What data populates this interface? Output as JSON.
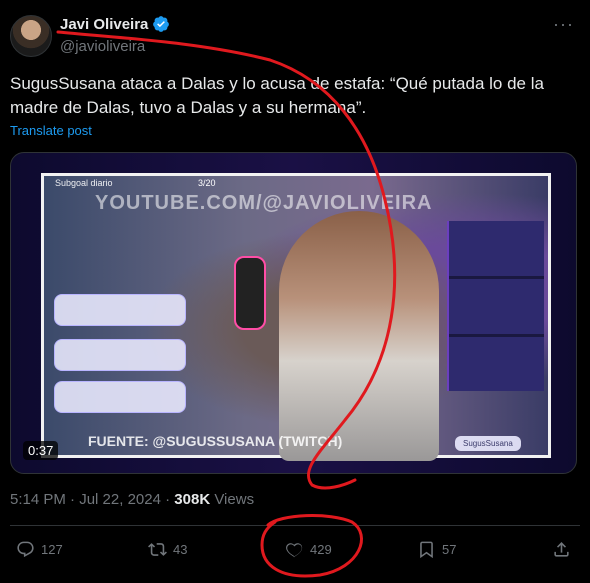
{
  "author": {
    "name": "Javi Oliveira",
    "handle": "@javioliveira"
  },
  "tweet": {
    "text": "SugusSusana ataca a Dalas y lo acusa de estafa: “Qué putada lo de la madre de Dalas, tuvo a Dalas y a su hermana”.",
    "translate_label": "Translate post"
  },
  "media": {
    "subgoal_label": "Subgoal diario",
    "subgoal_count": "3/20",
    "watermark": "YOUTUBE.COM/@JAVIOLIVEIRA",
    "source": "FUENTE: @SUGUSSUSANA (TWITCH)",
    "channel_tag": "SugusSusana",
    "duration": "0:37"
  },
  "meta": {
    "time": "5:14 PM",
    "separator": "·",
    "date": "Jul 22, 2024",
    "views_count": "308K",
    "views_label": "Views"
  },
  "actions": {
    "replies": "127",
    "reposts": "43",
    "likes": "429",
    "bookmarks": "57"
  },
  "colors": {
    "accent": "#1d9bf0",
    "annotation": "#e0191e",
    "verified": "#1d9bf0"
  }
}
